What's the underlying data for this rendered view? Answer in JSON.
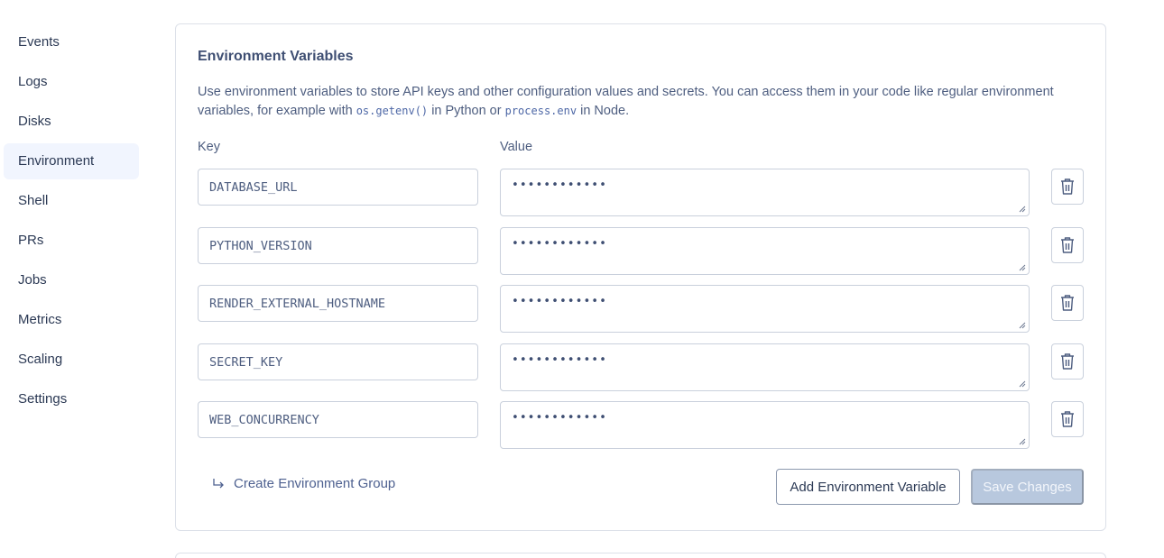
{
  "sidebar": {
    "items": [
      {
        "label": "Events"
      },
      {
        "label": "Logs"
      },
      {
        "label": "Disks"
      },
      {
        "label": "Environment",
        "active": true
      },
      {
        "label": "Shell"
      },
      {
        "label": "PRs"
      },
      {
        "label": "Jobs"
      },
      {
        "label": "Metrics"
      },
      {
        "label": "Scaling"
      },
      {
        "label": "Settings"
      }
    ]
  },
  "env": {
    "title": "Environment Variables",
    "desc_part1": "Use environment variables to store API keys and other configuration values and secrets. You can access them in your code like regular environment variables, for example with ",
    "desc_code1": "os.getenv()",
    "desc_part2": " in Python or ",
    "desc_code2": "process.env",
    "desc_part3": " in Node.",
    "key_label": "Key",
    "value_label": "Value",
    "rows": [
      {
        "key": "DATABASE_URL",
        "value": "••••••••••••"
      },
      {
        "key": "PYTHON_VERSION",
        "value": "••••••••••••"
      },
      {
        "key": "RENDER_EXTERNAL_HOSTNAME",
        "value": "••••••••••••"
      },
      {
        "key": "SECRET_KEY",
        "value": "••••••••••••"
      },
      {
        "key": "WEB_CONCURRENCY",
        "value": "••••••••••••"
      }
    ],
    "create_group_label": "Create Environment Group",
    "add_button": "Add Environment Variable",
    "save_button": "Save Changes"
  },
  "colors": {
    "active_bg": "#f1f5fe",
    "save_disabled_bg": "#b8c8de",
    "border": "#c9d0dc"
  },
  "icons": {
    "delete": "trash-icon",
    "create_group": "return-arrow-icon",
    "resize": "resize-grip-icon"
  }
}
